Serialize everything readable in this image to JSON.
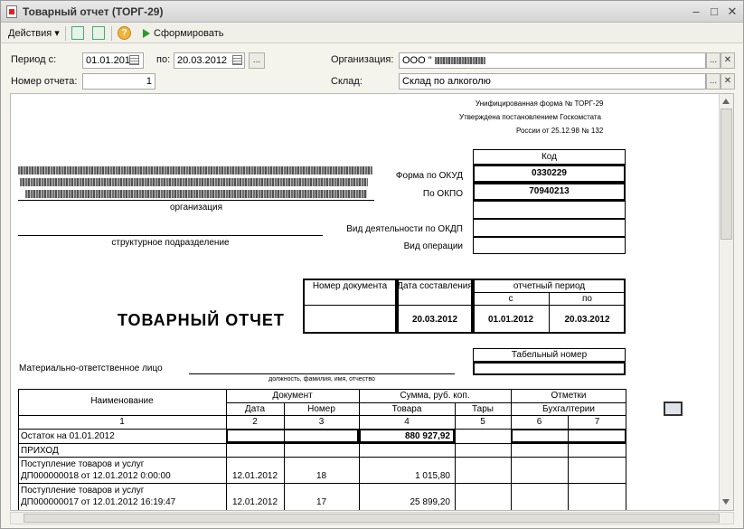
{
  "window": {
    "title": "Товарный отчет (ТОРГ-29)",
    "minimize": "–",
    "maximize": "□",
    "close": "✕"
  },
  "toolbar": {
    "actions_label": "Действия ▾",
    "help": "?",
    "form_label": "Сформировать"
  },
  "filters": {
    "period_label": "Период с:",
    "period_from": "01.01.2012",
    "to_label": "по:",
    "period_to": "20.03.2012",
    "dots": "...",
    "report_number_label": "Номер отчета:",
    "report_number": "1",
    "org_label": "Организация:",
    "org_value": "ООО \"",
    "warehouse_label": "Склад:",
    "warehouse_value": "Склад  по алкоголю",
    "sel": "...",
    "clear": "✕"
  },
  "doc": {
    "header_line1": "Унифицированная форма № ТОРГ-29",
    "header_line2": "Утверждена постановлением Госкомстата",
    "header_line3": "России от  25.12.98  № 132",
    "code_header": "Код",
    "okud_label": "Форма по ОКУД",
    "okud": "0330229",
    "okpo_label": "По ОКПО",
    "okpo": "70940213",
    "org_caption": "организация",
    "okdp_label": "Вид деятельности по ОКДП",
    "operation_label": "Вид операции",
    "subdivision_caption": "структурное подразделение",
    "doc_number_label": "Номер документа",
    "date_label": "Дата составления",
    "period_label": "отчетный период",
    "from_label": "с",
    "to_label": "по",
    "report_title": "ТОВАРНЫЙ  ОТЧЕТ",
    "date_value": "20.03.2012",
    "from_value": "01.01.2012",
    "to_value": "20.03.2012",
    "tab_number_label": "Табельный номер",
    "mol_label": "Материально-ответственное лицо",
    "mol_caption": "должность, фамилия, имя, отчество"
  },
  "table": {
    "h_name": "Наименование",
    "h_doc": "Документ",
    "h_date": "Дата",
    "h_number": "Номер",
    "h_sum": "Сумма, руб. коп.",
    "h_goods": "Товара",
    "h_tare": "Тары",
    "h_marks": "Отметки",
    "h_acc": "Бухгалтерии",
    "col_numbers": [
      "1",
      "2",
      "3",
      "4",
      "5",
      "6",
      "7"
    ],
    "rows": [
      {
        "name": "Остаток на 01.01.2012",
        "date": "",
        "number": "",
        "goods": "880 927,92"
      },
      {
        "name": "ПРИХОД",
        "date": "",
        "number": "",
        "goods": ""
      },
      {
        "name": "Поступление товаров и услуг",
        "name2": "ДП000000018 от 12.01.2012 0:00:00",
        "date": "12.01.2012",
        "number": "18",
        "goods": "1 015,80"
      },
      {
        "name": "Поступление товаров и услуг",
        "name2": "ДП000000017 от 12.01.2012 16:19:47",
        "date": "12.01.2012",
        "number": "17",
        "goods": "25 899,20"
      }
    ]
  }
}
